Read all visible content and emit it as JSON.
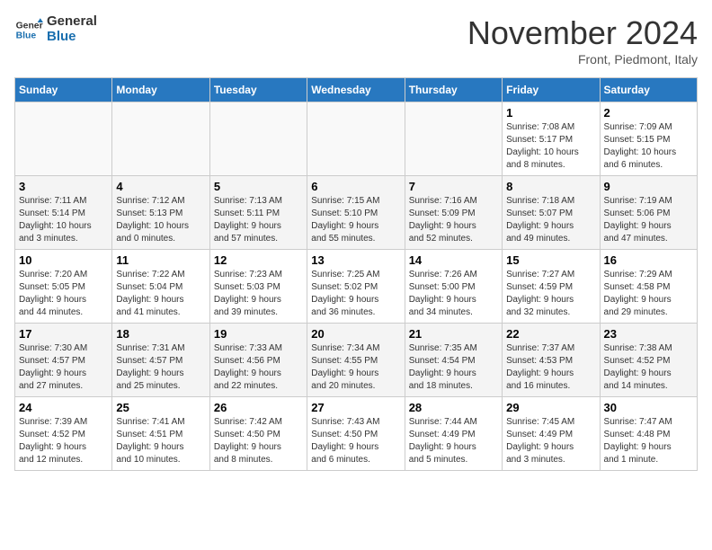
{
  "header": {
    "logo_line1": "General",
    "logo_line2": "Blue",
    "month_title": "November 2024",
    "location": "Front, Piedmont, Italy"
  },
  "weekdays": [
    "Sunday",
    "Monday",
    "Tuesday",
    "Wednesday",
    "Thursday",
    "Friday",
    "Saturday"
  ],
  "weeks": [
    [
      {
        "day": "",
        "info": ""
      },
      {
        "day": "",
        "info": ""
      },
      {
        "day": "",
        "info": ""
      },
      {
        "day": "",
        "info": ""
      },
      {
        "day": "",
        "info": ""
      },
      {
        "day": "1",
        "info": "Sunrise: 7:08 AM\nSunset: 5:17 PM\nDaylight: 10 hours\nand 8 minutes."
      },
      {
        "day": "2",
        "info": "Sunrise: 7:09 AM\nSunset: 5:15 PM\nDaylight: 10 hours\nand 6 minutes."
      }
    ],
    [
      {
        "day": "3",
        "info": "Sunrise: 7:11 AM\nSunset: 5:14 PM\nDaylight: 10 hours\nand 3 minutes."
      },
      {
        "day": "4",
        "info": "Sunrise: 7:12 AM\nSunset: 5:13 PM\nDaylight: 10 hours\nand 0 minutes."
      },
      {
        "day": "5",
        "info": "Sunrise: 7:13 AM\nSunset: 5:11 PM\nDaylight: 9 hours\nand 57 minutes."
      },
      {
        "day": "6",
        "info": "Sunrise: 7:15 AM\nSunset: 5:10 PM\nDaylight: 9 hours\nand 55 minutes."
      },
      {
        "day": "7",
        "info": "Sunrise: 7:16 AM\nSunset: 5:09 PM\nDaylight: 9 hours\nand 52 minutes."
      },
      {
        "day": "8",
        "info": "Sunrise: 7:18 AM\nSunset: 5:07 PM\nDaylight: 9 hours\nand 49 minutes."
      },
      {
        "day": "9",
        "info": "Sunrise: 7:19 AM\nSunset: 5:06 PM\nDaylight: 9 hours\nand 47 minutes."
      }
    ],
    [
      {
        "day": "10",
        "info": "Sunrise: 7:20 AM\nSunset: 5:05 PM\nDaylight: 9 hours\nand 44 minutes."
      },
      {
        "day": "11",
        "info": "Sunrise: 7:22 AM\nSunset: 5:04 PM\nDaylight: 9 hours\nand 41 minutes."
      },
      {
        "day": "12",
        "info": "Sunrise: 7:23 AM\nSunset: 5:03 PM\nDaylight: 9 hours\nand 39 minutes."
      },
      {
        "day": "13",
        "info": "Sunrise: 7:25 AM\nSunset: 5:02 PM\nDaylight: 9 hours\nand 36 minutes."
      },
      {
        "day": "14",
        "info": "Sunrise: 7:26 AM\nSunset: 5:00 PM\nDaylight: 9 hours\nand 34 minutes."
      },
      {
        "day": "15",
        "info": "Sunrise: 7:27 AM\nSunset: 4:59 PM\nDaylight: 9 hours\nand 32 minutes."
      },
      {
        "day": "16",
        "info": "Sunrise: 7:29 AM\nSunset: 4:58 PM\nDaylight: 9 hours\nand 29 minutes."
      }
    ],
    [
      {
        "day": "17",
        "info": "Sunrise: 7:30 AM\nSunset: 4:57 PM\nDaylight: 9 hours\nand 27 minutes."
      },
      {
        "day": "18",
        "info": "Sunrise: 7:31 AM\nSunset: 4:57 PM\nDaylight: 9 hours\nand 25 minutes."
      },
      {
        "day": "19",
        "info": "Sunrise: 7:33 AM\nSunset: 4:56 PM\nDaylight: 9 hours\nand 22 minutes."
      },
      {
        "day": "20",
        "info": "Sunrise: 7:34 AM\nSunset: 4:55 PM\nDaylight: 9 hours\nand 20 minutes."
      },
      {
        "day": "21",
        "info": "Sunrise: 7:35 AM\nSunset: 4:54 PM\nDaylight: 9 hours\nand 18 minutes."
      },
      {
        "day": "22",
        "info": "Sunrise: 7:37 AM\nSunset: 4:53 PM\nDaylight: 9 hours\nand 16 minutes."
      },
      {
        "day": "23",
        "info": "Sunrise: 7:38 AM\nSunset: 4:52 PM\nDaylight: 9 hours\nand 14 minutes."
      }
    ],
    [
      {
        "day": "24",
        "info": "Sunrise: 7:39 AM\nSunset: 4:52 PM\nDaylight: 9 hours\nand 12 minutes."
      },
      {
        "day": "25",
        "info": "Sunrise: 7:41 AM\nSunset: 4:51 PM\nDaylight: 9 hours\nand 10 minutes."
      },
      {
        "day": "26",
        "info": "Sunrise: 7:42 AM\nSunset: 4:50 PM\nDaylight: 9 hours\nand 8 minutes."
      },
      {
        "day": "27",
        "info": "Sunrise: 7:43 AM\nSunset: 4:50 PM\nDaylight: 9 hours\nand 6 minutes."
      },
      {
        "day": "28",
        "info": "Sunrise: 7:44 AM\nSunset: 4:49 PM\nDaylight: 9 hours\nand 5 minutes."
      },
      {
        "day": "29",
        "info": "Sunrise: 7:45 AM\nSunset: 4:49 PM\nDaylight: 9 hours\nand 3 minutes."
      },
      {
        "day": "30",
        "info": "Sunrise: 7:47 AM\nSunset: 4:48 PM\nDaylight: 9 hours\nand 1 minute."
      }
    ]
  ]
}
